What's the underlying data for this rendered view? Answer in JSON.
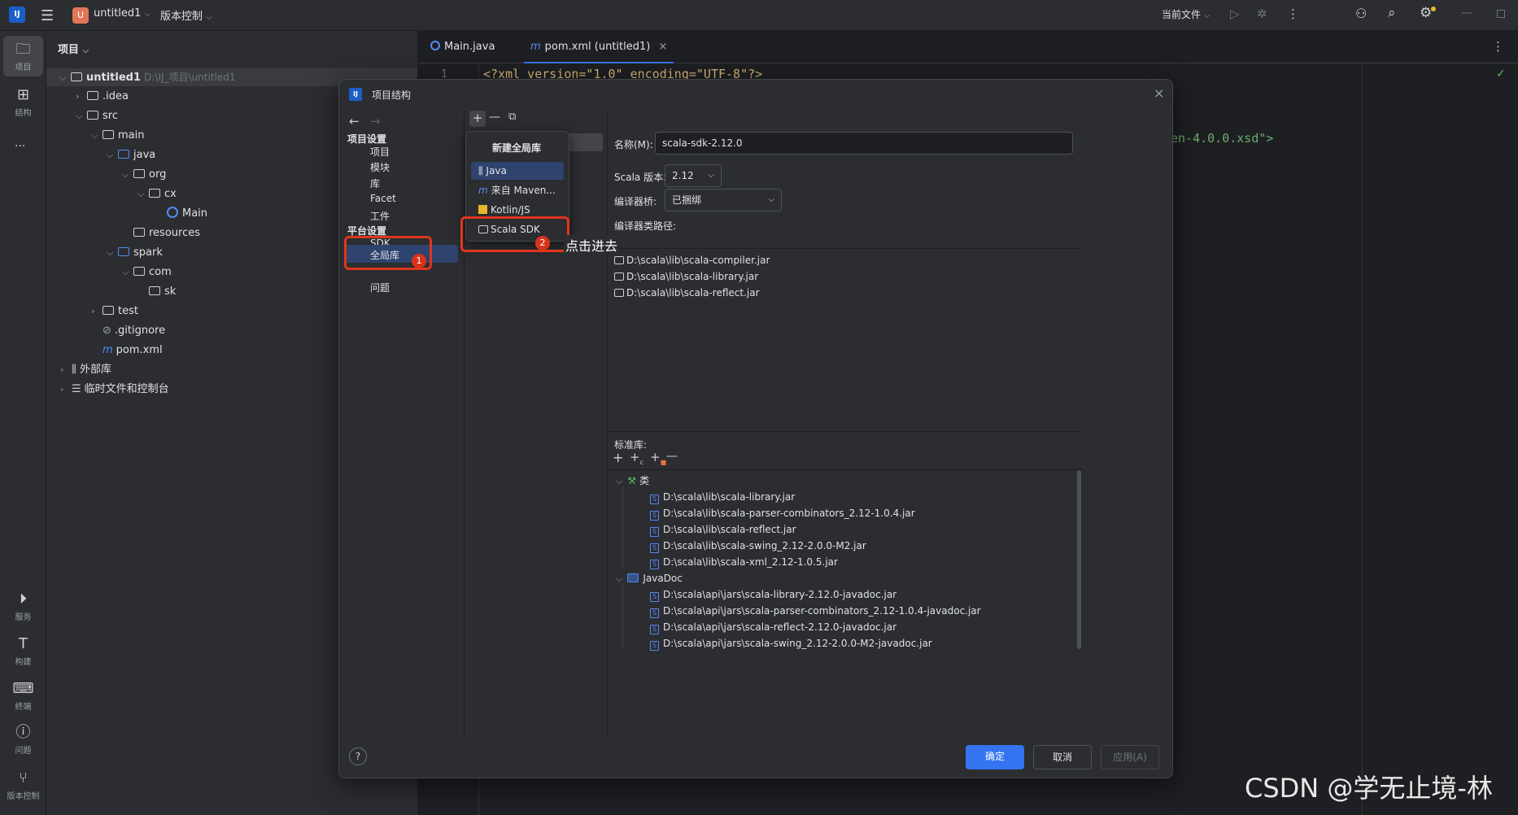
{
  "titlebar": {
    "app_badge": "U",
    "project_name": "untitled1",
    "vcs_menu": "版本控制",
    "run_config": "当前文件"
  },
  "stripe": {
    "top": [
      {
        "icon": "folder-icon",
        "label": "项目"
      },
      {
        "icon": "structure-icon",
        "label": "结构"
      }
    ],
    "more": "···",
    "bottom": [
      {
        "icon": "services-icon",
        "label": "服务"
      },
      {
        "icon": "build-icon",
        "label": "构建"
      },
      {
        "icon": "terminal-icon",
        "label": "终端"
      },
      {
        "icon": "problems-icon",
        "label": "问题"
      },
      {
        "icon": "git-icon",
        "label": "版本控制"
      }
    ]
  },
  "project_panel": {
    "title": "项目",
    "tree": [
      {
        "label": "untitled1",
        "hint": "D:\\IJ_项目\\untitled1"
      },
      {
        "label": ".idea"
      },
      {
        "label": "src"
      },
      {
        "label": "main"
      },
      {
        "label": "java"
      },
      {
        "label": "org"
      },
      {
        "label": "cx"
      },
      {
        "label": "Main"
      },
      {
        "label": "resources"
      },
      {
        "label": "spark"
      },
      {
        "label": "com"
      },
      {
        "label": "sk"
      },
      {
        "label": "test"
      },
      {
        "label": ".gitignore"
      },
      {
        "label": "pom.xml"
      },
      {
        "label": "外部库"
      },
      {
        "label": "临时文件和控制台"
      }
    ]
  },
  "editor": {
    "tabs": [
      {
        "label": "Main.java"
      },
      {
        "label": "pom.xml (untitled1)"
      }
    ],
    "line_number": "1",
    "code_line1": "<?xml version=\"1.0\" encoding=\"UTF-8\"?>",
    "code_fragment": "en-4.0.0.xsd\">"
  },
  "dialog": {
    "title": "项目结构",
    "nav": {
      "project_settings_header": "项目设置",
      "project_settings": [
        "项目",
        "模块",
        "库",
        "Facet",
        "工件"
      ],
      "platform_settings_header": "平台设置",
      "platform_settings": [
        "SDK",
        "全局库"
      ],
      "problems": "问题"
    },
    "popup": {
      "title": "新建全局库",
      "items": [
        "Java",
        "来自 Maven...",
        "Kotlin/JS",
        "Scala SDK"
      ]
    },
    "annotation": "点击进去",
    "badges": [
      "1",
      "2"
    ],
    "detail": {
      "name_label": "名称(M):",
      "name_value": "scala-sdk-2.12.0",
      "scala_version_label": "Scala 版本:",
      "scala_version_value": "2.12",
      "compiler_bridge_label": "编译器桥:",
      "compiler_bridge_value": "已捆绑",
      "compiler_classpath_label": "编译器类路径:",
      "compiler_classpath": [
        "D:\\scala\\lib\\scala-compiler.jar",
        "D:\\scala\\lib\\scala-library.jar",
        "D:\\scala\\lib\\scala-reflect.jar"
      ],
      "std_lib_label": "标准库:",
      "classes_group": "类",
      "classes": [
        "D:\\scala\\lib\\scala-library.jar",
        "D:\\scala\\lib\\scala-parser-combinators_2.12-1.0.4.jar",
        "D:\\scala\\lib\\scala-reflect.jar",
        "D:\\scala\\lib\\scala-swing_2.12-2.0.0-M2.jar",
        "D:\\scala\\lib\\scala-xml_2.12-1.0.5.jar"
      ],
      "javadoc_group": "JavaDoc",
      "javadoc": [
        "D:\\scala\\api\\jars\\scala-library-2.12.0-javadoc.jar",
        "D:\\scala\\api\\jars\\scala-parser-combinators_2.12-1.0.4-javadoc.jar",
        "D:\\scala\\api\\jars\\scala-reflect-2.12.0-javadoc.jar",
        "D:\\scala\\api\\jars\\scala-swing_2.12-2.0.0-M2-javadoc.jar"
      ]
    },
    "buttons": {
      "ok": "确定",
      "cancel": "取消",
      "apply": "应用(A)"
    },
    "help": "?"
  },
  "watermark": "CSDN @学无止境-林",
  "colors": {
    "accent": "#3574f0",
    "annotation_red": "#e0351e",
    "badge_red": "#d8321b"
  }
}
